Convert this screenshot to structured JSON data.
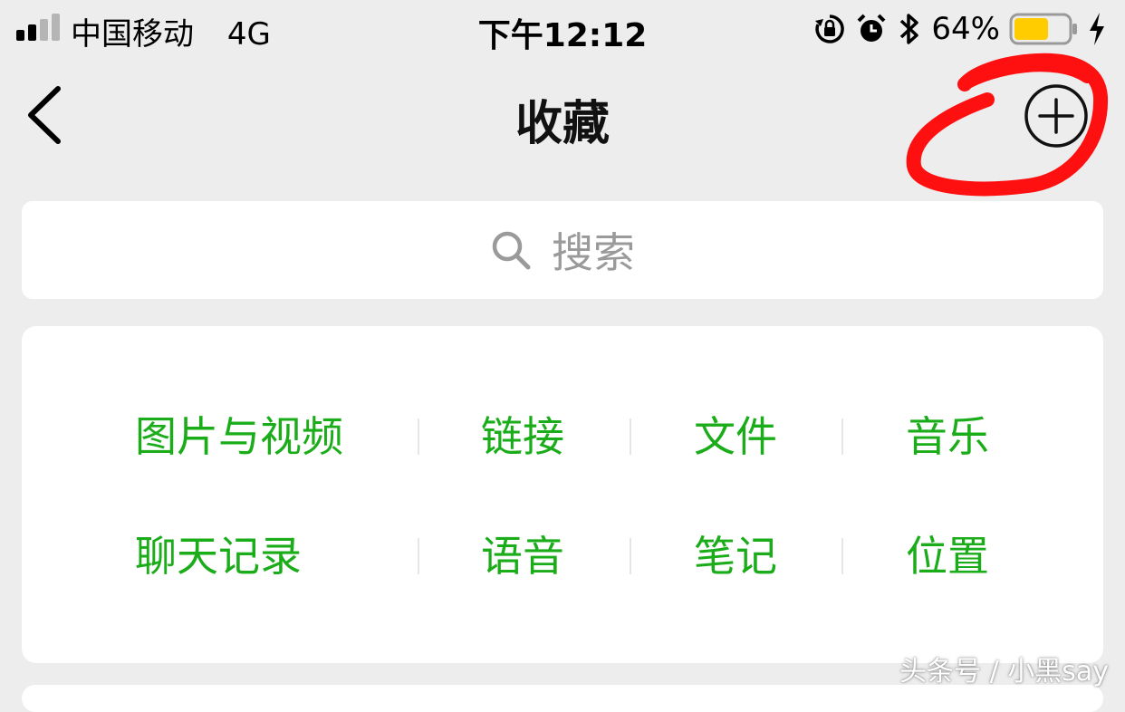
{
  "status_bar": {
    "carrier": "中国移动",
    "network": "4G",
    "time": "下午12:12",
    "battery_percent": "64%",
    "icons": [
      "signal-icon",
      "rotation-lock-icon",
      "alarm-icon",
      "bluetooth-icon",
      "battery-icon",
      "charging-icon"
    ],
    "battery_level": 0.64,
    "battery_color": "#ffcc00"
  },
  "nav": {
    "title": "收藏",
    "back_icon": "chevron-left-icon",
    "add_icon": "plus-circle-icon"
  },
  "search": {
    "placeholder": "搜索",
    "icon": "search-icon"
  },
  "categories": {
    "row1": [
      "图片与视频",
      "链接",
      "文件",
      "音乐"
    ],
    "row2": [
      "聊天记录",
      "语音",
      "笔记",
      "位置"
    ],
    "color": "#1aad19"
  },
  "annotation": {
    "color": "#ff0000"
  },
  "watermark": "头条号 / 小黑say"
}
